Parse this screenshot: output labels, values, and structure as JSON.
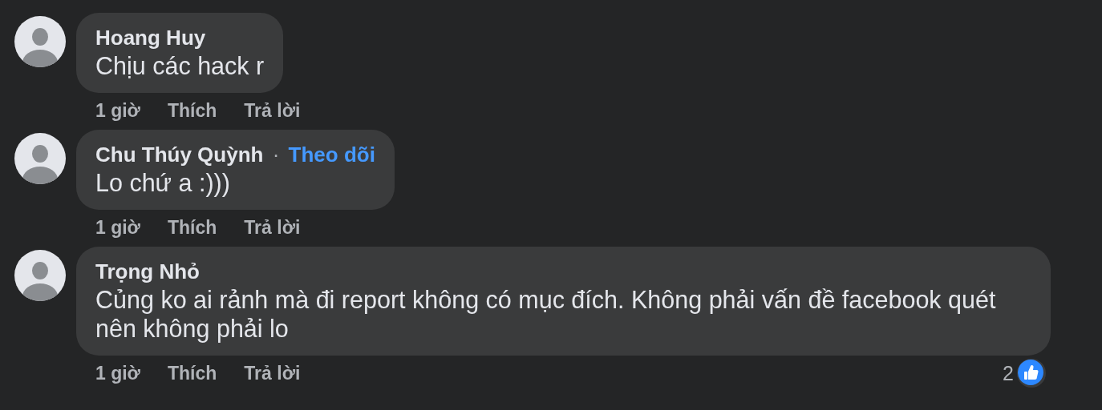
{
  "comments": [
    {
      "author": "Hoang Huy",
      "text": "Chịu các hack r",
      "time": "1 giờ",
      "like_label": "Thích",
      "reply_label": "Trả lời"
    },
    {
      "author": "Chu Thúy Quỳnh",
      "separator": "·",
      "follow_label": "Theo dõi",
      "text": "Lo chứ a :)))",
      "time": "1 giờ",
      "like_label": "Thích",
      "reply_label": "Trả lời"
    },
    {
      "author": "Trọng Nhỏ",
      "text": "Củng ko ai rảnh mà đi report không có mục đích. Không phải vấn đề facebook quét nên không phải lo",
      "time": "1 giờ",
      "like_label": "Thích",
      "reply_label": "Trả lời",
      "reaction_count": "2"
    }
  ]
}
